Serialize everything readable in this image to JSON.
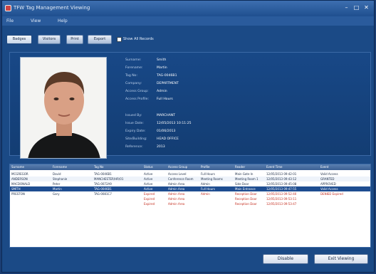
{
  "window": {
    "title": "TFW Tag Management Viewing",
    "min_glyph": "–",
    "max_glyph": "□",
    "close_glyph": "✕"
  },
  "menu": [
    "File",
    "View",
    "Help"
  ],
  "toolbar": {
    "buttons": [
      "Badges",
      "Visitors",
      "Print",
      "Export"
    ],
    "checkbox_label": "Show All Records"
  },
  "details": {
    "fields": [
      {
        "label": "Surname:",
        "value": "Smith"
      },
      {
        "label": "Forename:",
        "value": "Martin"
      },
      {
        "label": "Tag No:",
        "value": "TAG-0046B1"
      },
      {
        "label": "Company:",
        "value": "DEPARTMENT"
      },
      {
        "label": "Access Group:",
        "value": "Admin"
      },
      {
        "label": "Access Profile:",
        "value": "Full Hours"
      },
      {
        "label": "Issued By:",
        "value": "MARCHANT"
      },
      {
        "label": "Issue Date:",
        "value": "12/05/2013 10:11:25"
      },
      {
        "label": "Expiry Date:",
        "value": "01/06/2013"
      },
      {
        "label": "Site/Building:",
        "value": "HEAD OFFICE"
      },
      {
        "label": "Reference:",
        "value": "2013"
      }
    ]
  },
  "table": {
    "columns": [
      "Surname",
      "Forename",
      "Tag No",
      "Status",
      "Access Group",
      "Profile",
      "Reader",
      "Event Time",
      "Event"
    ],
    "rows": [
      [
        "MCGREGOR",
        "David",
        "TAG-0046B1",
        "Active",
        "Access Level",
        "Full Hours",
        "Main Gate In",
        "12/05/2013 09:42:01",
        "Valid Access"
      ],
      [
        "ANDERSON",
        "Stephanie",
        "MANCHESTER/HR/01",
        "Active",
        "Conference Room",
        "Meeting Rooms",
        "Meeting Room 1",
        "12/05/2013 09:43:12",
        "GRANTED"
      ],
      [
        "MACDONALD",
        "Peter",
        "TAG-0072A9",
        "Active",
        "Admin Area",
        "Admin",
        "Side Door",
        "12/05/2013 09:45:08",
        "APPROVED"
      ],
      [
        "SMITH",
        "Martin",
        "TAG-0046B1",
        "Active",
        "Admin Area",
        "Full Hours",
        "Main Entrance",
        "12/05/2013 09:47:55",
        "Valid Access"
      ],
      [
        "PRESTON",
        "Gary",
        "TAG-0081C7",
        "Expired",
        "Admin Area",
        "Admin",
        "Reception Door",
        "12/05/2013 09:52:40",
        "DENIED Expired"
      ],
      [
        "",
        "",
        "",
        "Expired",
        "Admin Area",
        "",
        "Reception Door",
        "12/05/2013 09:53:11",
        ""
      ],
      [
        "",
        "",
        "",
        "Expired",
        "Admin Area",
        "",
        "Reception Door",
        "12/05/2013 09:53:47",
        ""
      ]
    ]
  },
  "footer": {
    "disable_label": "Disable",
    "exit_label": "Exit Viewing"
  },
  "colors": {
    "selected_row": "#1e4d91",
    "denied_text": "#c42d1f"
  }
}
